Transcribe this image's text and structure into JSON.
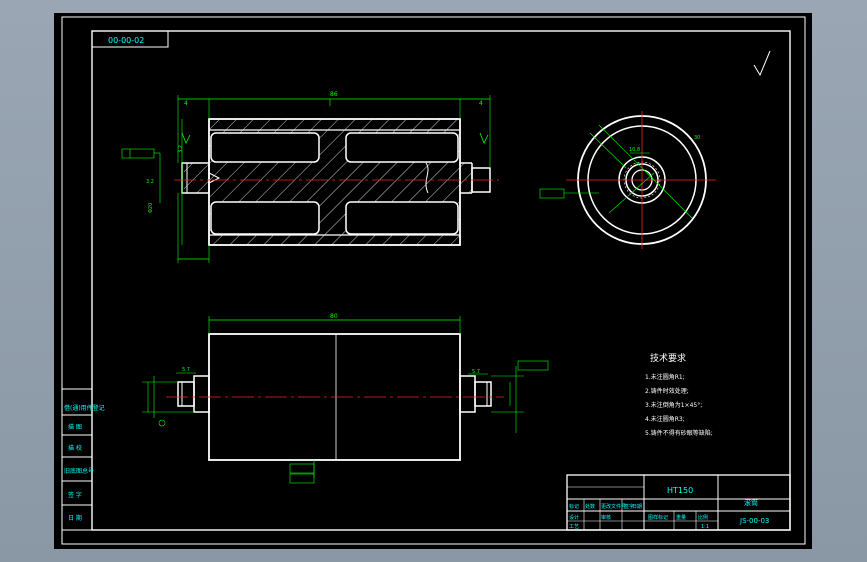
{
  "drawing": {
    "stamp_code": "00-00-02",
    "material": "HT150",
    "part_name": "滚筒",
    "drawing_number": "JS-00-03",
    "tech_title": "技术要求",
    "tech_notes": [
      "1.未注圆角R1;",
      "2.铸件时效处理;",
      "3.未注倒角为1×45°;",
      "4.未注圆角R3;",
      "5.铸件不得有砂眼等缺陷;"
    ],
    "left_strip": [
      "借(通)用件登记",
      "描 图",
      "描 校",
      "旧底图总号",
      "签 字",
      "日 期"
    ],
    "title_block_cells": [
      "标记",
      "处数",
      "更改文件号",
      "签字",
      "日期",
      "设计",
      "审核",
      "工艺",
      "图样标记",
      "重量",
      "比例",
      "1:1"
    ],
    "dims": {
      "overall": "86",
      "bottom_len": "80",
      "shaft_small": "5.7",
      "diameter_big": "30",
      "d_left": "4",
      "d_right": "4",
      "hole": "10.8"
    },
    "colors": {
      "sheet": "#000000",
      "outline": "#ffffff",
      "dimension": "#00ff00",
      "centerline": "#ff2020",
      "text": "#00ffff"
    }
  }
}
